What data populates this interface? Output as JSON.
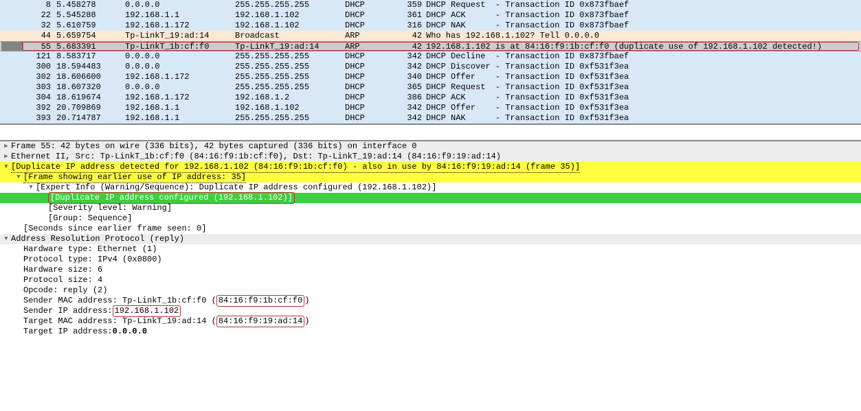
{
  "packets": [
    {
      "no": "8",
      "time": "5.458278",
      "src": "0.0.0.0",
      "dst": "255.255.255.255",
      "proto": "DHCP",
      "len": "359",
      "info": "DHCP Request  - Transaction ID 0x873fbaef",
      "bg": "bg-blue",
      "sel": false,
      "redbox": false
    },
    {
      "no": "22",
      "time": "5.545288",
      "src": "192.168.1.1",
      "dst": "192.168.1.102",
      "proto": "DHCP",
      "len": "361",
      "info": "DHCP ACK      - Transaction ID 0x873fbaef",
      "bg": "bg-blue",
      "sel": false,
      "redbox": false
    },
    {
      "no": "32",
      "time": "5.610759",
      "src": "192.168.1.172",
      "dst": "192.168.1.102",
      "proto": "DHCP",
      "len": "316",
      "info": "DHCP NAK      - Transaction ID 0x873fbaef",
      "bg": "bg-blue",
      "sel": false,
      "redbox": false
    },
    {
      "no": "44",
      "time": "5.659754",
      "src": "Tp-LinkT_19:ad:14",
      "dst": "Broadcast",
      "proto": "ARP",
      "len": "42",
      "info": "Who has 192.168.1.102? Tell 0.0.0.0",
      "bg": "bg-cream",
      "sel": false,
      "redbox": false
    },
    {
      "no": "55",
      "time": "5.683391",
      "src": "Tp-LinkT_1b:cf:f0",
      "dst": "Tp-LinkT_19:ad:14",
      "proto": "ARP",
      "len": "42",
      "info": "192.168.1.102 is at 84:16:f9:1b:cf:f0 (duplicate use of 192.168.1.102 detected!)",
      "bg": "bg-grey-sel",
      "sel": true,
      "redbox": true
    },
    {
      "no": "121",
      "time": "8.583717",
      "src": "0.0.0.0",
      "dst": "255.255.255.255",
      "proto": "DHCP",
      "len": "342",
      "info": "DHCP Decline  - Transaction ID 0x873fbaef",
      "bg": "bg-blue",
      "sel": false,
      "redbox": false
    },
    {
      "no": "300",
      "time": "18.594483",
      "src": "0.0.0.0",
      "dst": "255.255.255.255",
      "proto": "DHCP",
      "len": "342",
      "info": "DHCP Discover - Transaction ID 0xf531f3ea",
      "bg": "bg-blue",
      "sel": false,
      "redbox": false
    },
    {
      "no": "302",
      "time": "18.606600",
      "src": "192.168.1.172",
      "dst": "255.255.255.255",
      "proto": "DHCP",
      "len": "340",
      "info": "DHCP Offer    - Transaction ID 0xf531f3ea",
      "bg": "bg-blue",
      "sel": false,
      "redbox": false
    },
    {
      "no": "303",
      "time": "18.607320",
      "src": "0.0.0.0",
      "dst": "255.255.255.255",
      "proto": "DHCP",
      "len": "365",
      "info": "DHCP Request  - Transaction ID 0xf531f3ea",
      "bg": "bg-blue",
      "sel": false,
      "redbox": false
    },
    {
      "no": "304",
      "time": "18.619674",
      "src": "192.168.1.172",
      "dst": "192.168.1.2",
      "proto": "DHCP",
      "len": "386",
      "info": "DHCP ACK      - Transaction ID 0xf531f3ea",
      "bg": "bg-blue",
      "sel": false,
      "redbox": false
    },
    {
      "no": "392",
      "time": "20.709869",
      "src": "192.168.1.1",
      "dst": "192.168.1.102",
      "proto": "DHCP",
      "len": "342",
      "info": "DHCP Offer    - Transaction ID 0xf531f3ea",
      "bg": "bg-blue",
      "sel": false,
      "redbox": false
    },
    {
      "no": "393",
      "time": "20.714787",
      "src": "192.168.1.1",
      "dst": "255.255.255.255",
      "proto": "DHCP",
      "len": "342",
      "info": "DHCP NAK      - Transaction ID 0xf531f3ea",
      "bg": "bg-blue",
      "sel": false,
      "redbox": false
    }
  ],
  "details": {
    "frame": "Frame 55: 42 bytes on wire (336 bits), 42 bytes captured (336 bits) on interface 0",
    "eth": "Ethernet II, Src: Tp-LinkT_1b:cf:f0 (84:16:f9:1b:cf:f0), Dst: Tp-LinkT_19:ad:14 (84:16:f9:19:ad:14)",
    "dupip_main": "[Duplicate IP address detected for 192.168.1.102 (84:16:f9:1b:cf:f0) - also in use by 84:16:f9:19:ad:14 (frame 35)]",
    "frame_earlier": "[Frame showing earlier use of IP address: 35]",
    "expert_info": "[Expert Info (Warning/Sequence): Duplicate IP address configured (192.168.1.102)]",
    "dup_conf": "[Duplicate IP address configured (192.168.1.102)]",
    "severity": "[Severity level: Warning]",
    "group": "[Group: Sequence]",
    "seconds": "[Seconds since earlier frame seen: 0]",
    "arp_header": "Address Resolution Protocol (reply)",
    "hw_type": "Hardware type: Ethernet (1)",
    "proto_type": "Protocol type: IPv4 (0x0800)",
    "hw_size": "Hardware size: 6",
    "proto_size": "Protocol size: 4",
    "opcode": "Opcode: reply (2)",
    "sender_mac_label": "Sender MAC address: Tp-LinkT_1b:cf:f0 (",
    "sender_mac_val": "84:16:f9:1b:cf:f0",
    "sender_mac_close": ")",
    "sender_ip_label": "Sender IP address: ",
    "sender_ip_val": "192.168.1.102",
    "target_mac_label": "Target MAC address: Tp-LinkT_19:ad:14 (",
    "target_mac_val": "84:16:f9:19:ad:14",
    "target_mac_close": ")",
    "target_ip_label": "Target IP address: ",
    "target_ip_val": "0.0.0.0"
  }
}
